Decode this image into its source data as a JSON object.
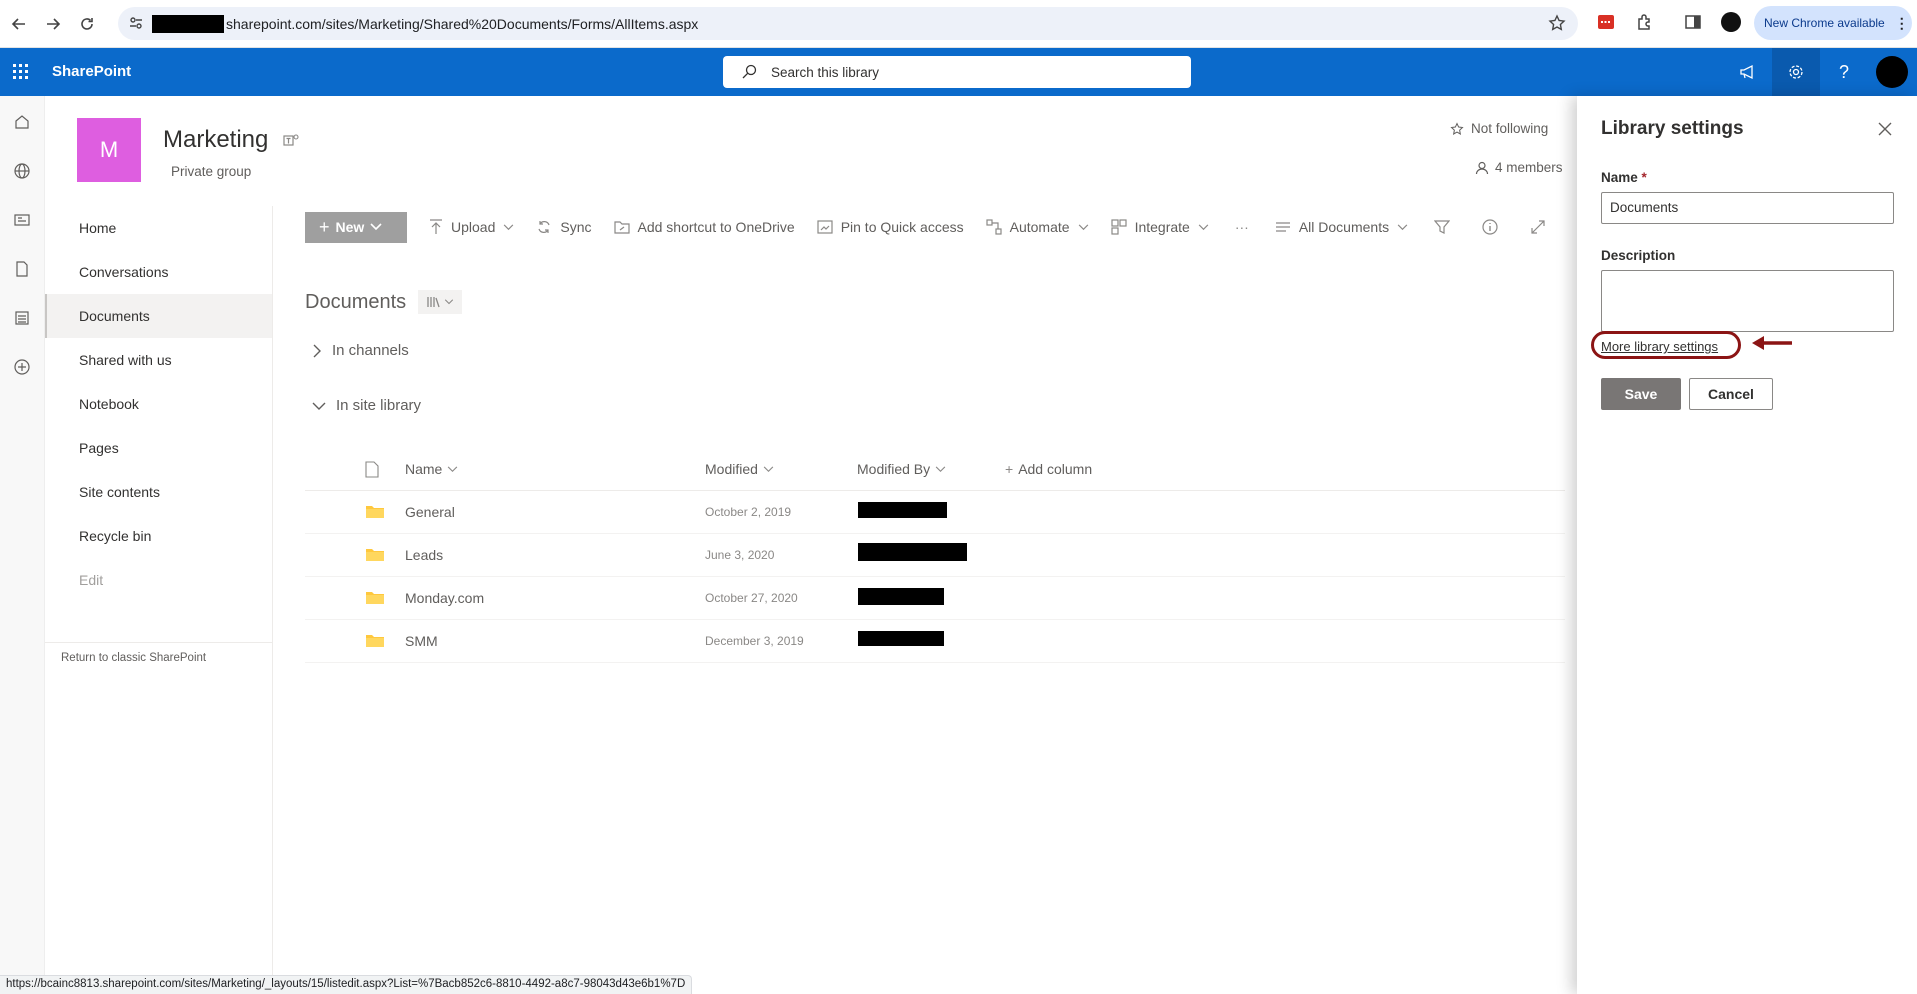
{
  "browser": {
    "url": "sharepoint.com/sites/Marketing/Shared%20Documents/Forms/AllItems.aspx",
    "new_chrome_label": "New Chrome available",
    "status_url": "https://bcainc8813.sharepoint.com/sites/Marketing/_layouts/15/listedit.aspx?List=%7Bacb852c6-8810-4492-a8c7-98043d43e6b1%7D"
  },
  "suite_bar": {
    "brand": "SharePoint",
    "search_placeholder": "Search this library"
  },
  "site": {
    "logo_letter": "M",
    "title": "Marketing",
    "subtitle": "Private group",
    "follow_label": "Not following",
    "members_label": "4 members"
  },
  "left_nav": {
    "items": [
      {
        "label": "Home"
      },
      {
        "label": "Conversations"
      },
      {
        "label": "Documents",
        "active": true
      },
      {
        "label": "Shared with us"
      },
      {
        "label": "Notebook"
      },
      {
        "label": "Pages"
      },
      {
        "label": "Site contents"
      },
      {
        "label": "Recycle bin"
      },
      {
        "label": "Edit"
      }
    ],
    "classic_link": "Return to classic SharePoint"
  },
  "command_bar": {
    "new": "New",
    "upload": "Upload",
    "sync": "Sync",
    "shortcut": "Add shortcut to OneDrive",
    "pin": "Pin to Quick access",
    "automate": "Automate",
    "integrate": "Integrate",
    "more": "···",
    "view": "All Documents"
  },
  "library": {
    "title": "Documents",
    "groups": [
      "In channels",
      "In site library"
    ],
    "columns": {
      "name": "Name",
      "modified": "Modified",
      "modified_by": "Modified By",
      "add": "Add column"
    },
    "rows": [
      {
        "name": "General",
        "modified": "October 2, 2019"
      },
      {
        "name": "Leads",
        "modified": "June 3, 2020"
      },
      {
        "name": "Monday.com",
        "modified": "October 27, 2020"
      },
      {
        "name": "SMM",
        "modified": "December 3, 2019"
      }
    ]
  },
  "panel": {
    "title": "Library settings",
    "name_label": "Name",
    "required_mark": "*",
    "name_value": "Documents",
    "description_label": "Description",
    "description_value": "",
    "more_link": "More library settings",
    "save": "Save",
    "cancel": "Cancel"
  },
  "colors": {
    "suite_bar": "#0b6acb",
    "site_logo": "#de5ee0",
    "annotation": "#8b1414"
  }
}
